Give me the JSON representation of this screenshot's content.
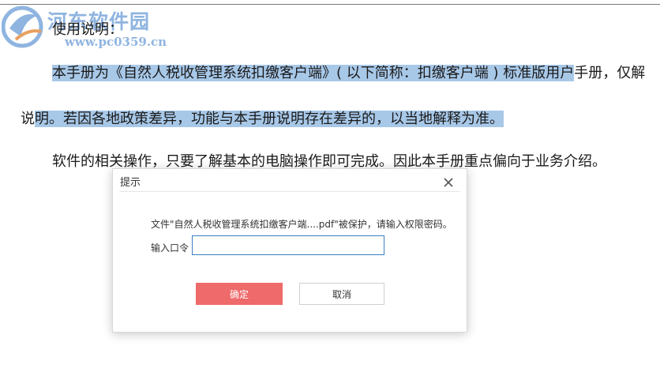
{
  "watermark": {
    "name": "河东软件园",
    "url": "www.pc0359.cn"
  },
  "document": {
    "usage_heading": "使用说明：",
    "para1_highlighted": "本手册为《自然人税收管理系统扣缴客户端》( 以下简称：扣缴客户端 ) 标准版用户",
    "para1_rest": "手册，仅解",
    "para1b_plain": "说",
    "para1b_highlighted": "明。若因各地政策差异，功能与本手册说明存在差异的，以当地解释为准。",
    "para2": "软件的相关操作，只要了解基本的电脑操作即可完成。因此本手册重点偏向于业务介绍。"
  },
  "dialog": {
    "title": "提示",
    "message": "文件\"自然人税收管理系统扣缴客户端....pdf\"被保护，请输入权限密码。",
    "password_label": "输入口令",
    "password_value": "",
    "ok_label": "确定",
    "cancel_label": "取消"
  },
  "colors": {
    "highlight": "#a8c8e8",
    "ok_button": "#ef6a6a",
    "input_border": "#3b7fc4",
    "watermark": "#8fb4e0"
  }
}
